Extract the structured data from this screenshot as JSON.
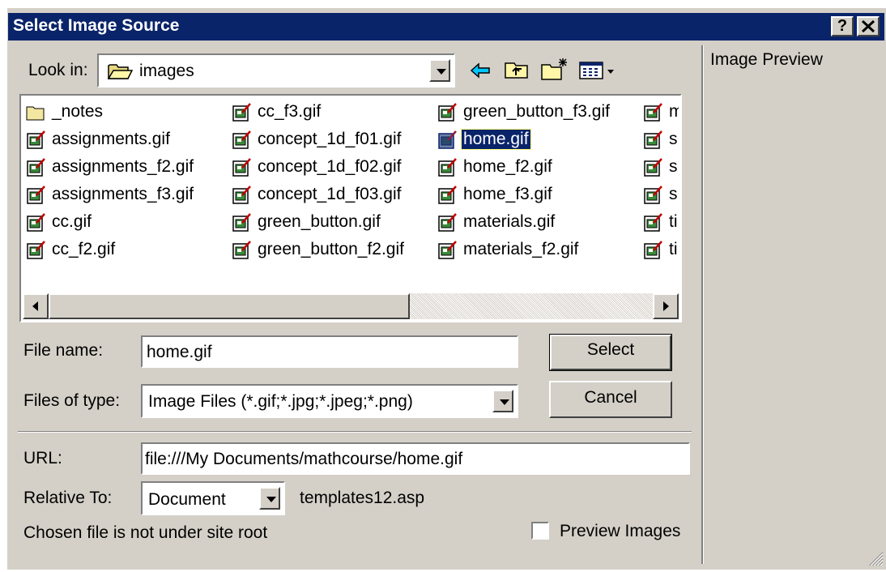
{
  "dialog": {
    "title": "Select Image Source",
    "help_button": "?",
    "close_button": "✕"
  },
  "look_in": {
    "label": "Look in:",
    "value": "images"
  },
  "toolbar": {
    "back_icon": "arrow-left-icon",
    "up_icon": "folder-up-icon",
    "new_folder_icon": "new-folder-icon",
    "view_menu_icon": "view-menu-icon"
  },
  "files": {
    "col1": [
      "_notes",
      "assignments.gif",
      "assignments_f2.gif",
      "assignments_f3.gif",
      "cc.gif",
      "cc_f2.gif"
    ],
    "col2": [
      "cc_f3.gif",
      "concept_1d_f01.gif",
      "concept_1d_f02.gif",
      "concept_1d_f03.gif",
      "green_button.gif",
      "green_button_f2.gif"
    ],
    "col3": [
      "green_button_f3.gif",
      "home.gif",
      "home_f2.gif",
      "home_f3.gif",
      "materials.gif",
      "materials_f2.gif"
    ],
    "col4": [
      "m",
      "s",
      "s",
      "s",
      "ti",
      "ti"
    ],
    "selected": "home.gif"
  },
  "file_name": {
    "label": "File name:",
    "value": "home.gif"
  },
  "files_of_type": {
    "label": "Files of type:",
    "value": "Image Files (*.gif;*.jpg;*.jpeg;*.png)"
  },
  "buttons": {
    "select": "Select",
    "cancel": "Cancel"
  },
  "url": {
    "label": "URL:",
    "value": "file:///My Documents/mathcourse/home.gif"
  },
  "relative_to": {
    "label": "Relative To:",
    "value": "Document",
    "target": "templates12.asp"
  },
  "status": "Chosen file is not under site root",
  "preview_images": {
    "label": "Preview Images",
    "checked": false
  },
  "preview_panel": {
    "title": "Image Preview"
  },
  "colors": {
    "title_bar": "#0a246a",
    "dialog_bg": "#d4d0c8",
    "selection": "#0a246a"
  }
}
